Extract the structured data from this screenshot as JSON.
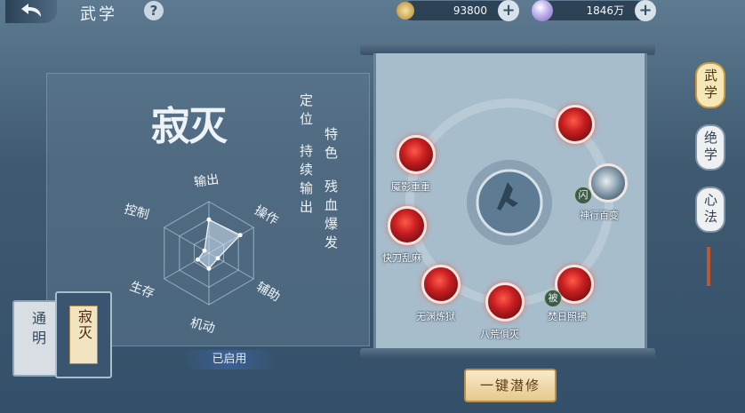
{
  "header": {
    "title": "武学",
    "help_label": "?",
    "currency1": {
      "value": "93800",
      "icon": "copper-coin-icon"
    },
    "currency2": {
      "value": "1846万",
      "icon": "pearl-icon"
    }
  },
  "school": {
    "name": "寂灭",
    "role_label": "定位",
    "role_value": "持续输出",
    "trait_label": "特色",
    "trait_value": "残血爆发"
  },
  "radar": {
    "axes": [
      "输出",
      "操作",
      "辅助",
      "机动",
      "生存",
      "控制"
    ],
    "values": [
      0.65,
      0.7,
      0.2,
      0.3,
      0.25,
      0.1
    ]
  },
  "bottom_left": {
    "book1_label": "通明",
    "book2_label": "寂灭",
    "enabled_label": "已启用"
  },
  "skills": [
    {
      "name": "",
      "type": "red"
    },
    {
      "name": "魇影重重",
      "type": "red"
    },
    {
      "name": "神行百变",
      "type": "white",
      "tag": "闪"
    },
    {
      "name": "快刀乱麻",
      "type": "red"
    },
    {
      "name": "无渊炼狱",
      "type": "red"
    },
    {
      "name": "八荒俱灭",
      "type": "red"
    },
    {
      "name": "焚日照拂",
      "type": "red",
      "tag": "被"
    }
  ],
  "cultivate_button": "一键潜修",
  "side_tabs": [
    "武学",
    "绝学",
    "心法"
  ]
}
